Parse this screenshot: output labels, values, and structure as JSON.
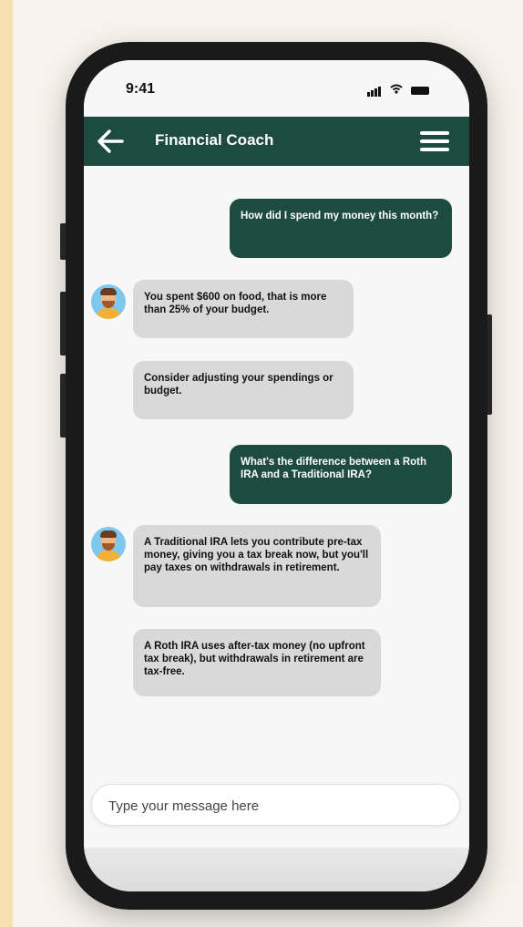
{
  "status_bar": {
    "time": "9:41"
  },
  "header": {
    "title": "Financial Coach"
  },
  "messages": [
    {
      "sender": "user",
      "text": "How did I spend my money this month?"
    },
    {
      "sender": "bot",
      "text": "You spent $600 on food, that is more than 25% of your budget."
    },
    {
      "sender": "bot",
      "text": "Consider adjusting your spendings or budget."
    },
    {
      "sender": "user",
      "text": "What's the difference between a Roth IRA and a Traditional IRA?"
    },
    {
      "sender": "bot",
      "text": "A Traditional IRA lets you contribute pre-tax money, giving you a tax break now, but you'll pay taxes on withdrawals in retirement."
    },
    {
      "sender": "bot",
      "text": "A Roth IRA uses after-tax money (no upfront tax break), but withdrawals in retirement are tax-free."
    }
  ],
  "composer": {
    "placeholder": "Type your message here"
  },
  "colors": {
    "accent": "#1d4b40",
    "bot_bubble": "#d9d9d9",
    "avatar_bg": "#7ec8f0"
  },
  "icons": {
    "back": "back-arrow-icon",
    "menu": "hamburger-menu-icon",
    "avatar": "coach-avatar-icon"
  }
}
